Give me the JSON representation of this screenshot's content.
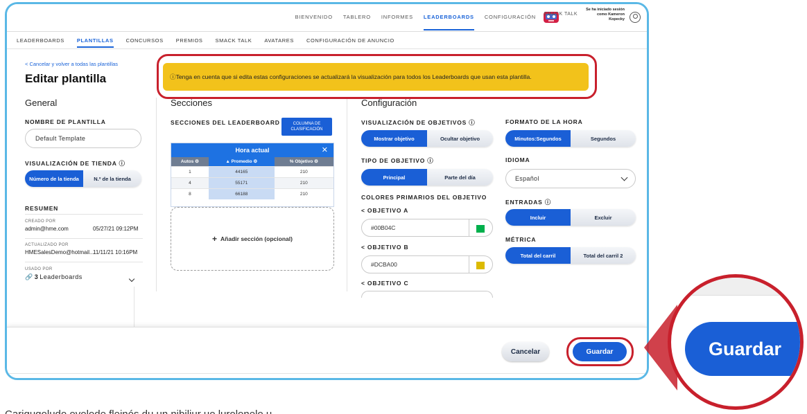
{
  "top_nav": {
    "items": [
      "BIENVENIDO",
      "TABLERO",
      "INFORMES",
      "LEADERBOARDS",
      "CONFIGURACIÓN"
    ],
    "active": "LEADERBOARDS",
    "smack_talk": "SMACK TALK",
    "login_line1": "Se ha iniciado sesión",
    "login_line2": "como Kameron",
    "login_line3": "Kopecky"
  },
  "sub_nav": {
    "items": [
      "LEADERBOARDS",
      "PLANTILLAS",
      "CONCURSOS",
      "PREMIOS",
      "SMACK TALK",
      "AVATARES",
      "CONFIGURACIÓN DE ANUNCIO"
    ],
    "active": "PLANTILLAS"
  },
  "page": {
    "back_link": "< Cancelar y volver a todas las plantillas",
    "title": "Editar plantilla",
    "warning": "ⓘTenga en cuenta que si edita estas configuraciones se actualizará la visualización para todos los Leaderboards que usan esta plantilla."
  },
  "general": {
    "heading": "General",
    "name_label": "NOMBRE DE PLANTILLA",
    "name_value": "Default Template",
    "store_label": "VISUALIZACIÓN DE TIENDA ⓘ",
    "store_options": [
      "Número de la tienda",
      "N.º de la tienda"
    ],
    "summary_heading": "RESUMEN",
    "created_label": "CREADO POR",
    "created_user": "admin@hme.com",
    "created_date": "05/27/21 09:12PM",
    "updated_label": "ACTUALIZADO POR",
    "updated_user": "HMESalesDemo@hotmail....",
    "updated_date": "11/11/21 10:16PM",
    "used_label": "USADO POR",
    "used_count": "3",
    "used_text": "Leaderboards"
  },
  "sections": {
    "heading": "Secciones",
    "label": "SECCIONES DEL LEADERBOARD ⓘ",
    "column_button": "COLUMNA DE CLASIFICACIÓN",
    "card_title": "Hora actual",
    "close": "✕",
    "columns": [
      "Autos ⚙",
      "▲ Promedio ⚙",
      "% Objetivo ⚙"
    ],
    "rows": [
      [
        "1",
        "44165",
        "210"
      ],
      [
        "4",
        "55171",
        "210"
      ],
      [
        "8",
        "66188",
        "210"
      ]
    ],
    "add_section": "Añadir sección (opcional)"
  },
  "config": {
    "heading": "Configuración",
    "goals_label": "VISUALIZACIÓN DE OBJETIVOS ⓘ",
    "goals_options": [
      "Mostrar objetivo",
      "Ocultar objetivo"
    ],
    "goal_type_label": "TIPO DE OBJETIVO ⓘ",
    "goal_type_options": [
      "Principal",
      "Parte del día"
    ],
    "colors_label": "COLORES PRIMARIOS DEL OBJETIVO",
    "goal_a_label": "< OBJETIVO A",
    "goal_a_value": "#00B04C",
    "goal_a_color": "#00B04C",
    "goal_b_label": "< OBJETIVO B",
    "goal_b_value": "#DCBA00",
    "goal_b_color": "#DCBA00",
    "goal_c_label": "< OBJETIVO C",
    "time_label": "FORMATO DE LA HORA",
    "time_options": [
      "Minutos:Segundos",
      "Segundos"
    ],
    "language_label": "IDIOMA",
    "language_value": "Español",
    "entries_label": "ENTRADAS ⓘ",
    "entries_options": [
      "Incluir",
      "Excluir"
    ],
    "metric_label": "MÉTRICA",
    "metric_options": [
      "Total del carril",
      "Total del carril 2"
    ]
  },
  "footer": {
    "cancel": "Cancelar",
    "save": "Guardar"
  },
  "zoom": {
    "save": "Guardar"
  },
  "caption": "Carigugoludo ovolode fleinós du un nibiliur uo lurolonelo u..."
}
